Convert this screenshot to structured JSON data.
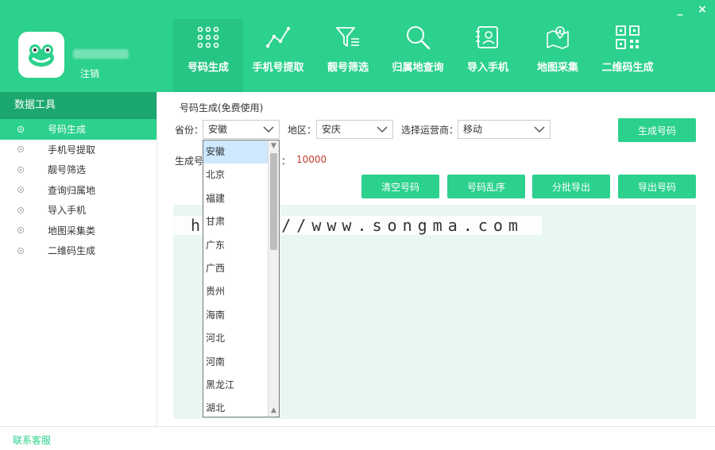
{
  "window": {
    "minimize_label": "_",
    "close_label": "×"
  },
  "account": {
    "logout_label": "注销"
  },
  "nav": [
    {
      "label": "号码生成",
      "icon": "dots-grid-icon",
      "active": true
    },
    {
      "label": "手机号提取",
      "icon": "line-chart-icon"
    },
    {
      "label": "靓号筛选",
      "icon": "filter-icon"
    },
    {
      "label": "归属地查询",
      "icon": "search-icon"
    },
    {
      "label": "导入手机",
      "icon": "contact-card-icon"
    },
    {
      "label": "地图采集",
      "icon": "map-pin-icon"
    },
    {
      "label": "二维码生成",
      "icon": "qr-code-icon"
    }
  ],
  "sidebar": {
    "title": "数据工具",
    "items": [
      {
        "label": "号码生成"
      },
      {
        "label": "手机号提取"
      },
      {
        "label": "靓号筛选"
      },
      {
        "label": "查询归属地"
      },
      {
        "label": "导入手机"
      },
      {
        "label": "地图采集类"
      },
      {
        "label": "二维码生成"
      }
    ]
  },
  "main": {
    "section_title": "号码生成(免费使用)",
    "province_label": "省份：",
    "province_value": "安徽",
    "region_label": "地区：",
    "region_value": "安庆",
    "carrier_label": "选择运营商：",
    "carrier_value": "移动",
    "generate_button": "生成号码",
    "gen_label": "生成号",
    "gen_label_end": "：",
    "gen_count": "10000",
    "clear_button": "清空号码",
    "shuffle_button": "号码乱序",
    "batch_export_button": "分批导出",
    "export_button": "导出号码"
  },
  "dropdown": {
    "options": [
      "安徽",
      "北京",
      "福建",
      "甘肃",
      "广东",
      "广西",
      "贵州",
      "海南",
      "河北",
      "河南",
      "黑龙江",
      "湖北"
    ],
    "selected": "安徽"
  },
  "watermark": "https://www.songma.com",
  "footer": {
    "contact_label": "联系客服"
  },
  "colors": {
    "accent": "#2bd18c",
    "sidebar_header": "#1ba76e",
    "result_bg": "#e8f8f0",
    "count": "#c0392b"
  }
}
